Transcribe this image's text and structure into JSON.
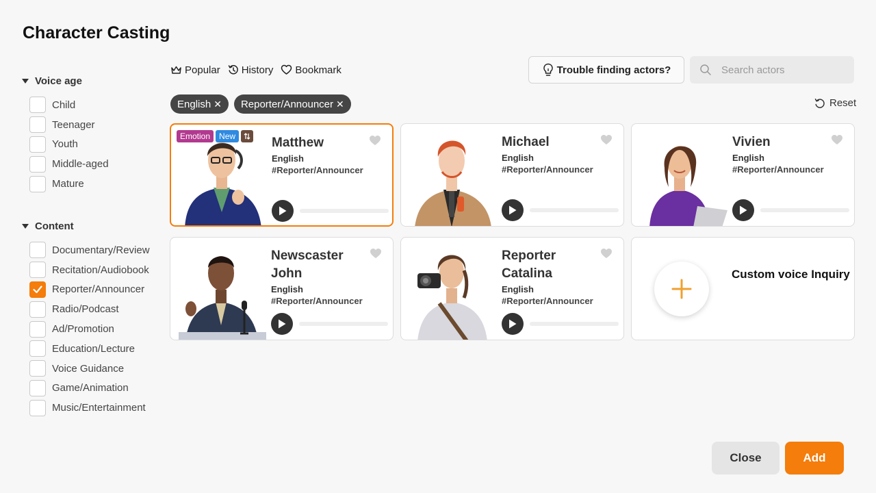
{
  "title": "Character Casting",
  "sidebar": {
    "voice_age": {
      "heading": "Voice age",
      "options": [
        {
          "label": "Child",
          "checked": false
        },
        {
          "label": "Teenager",
          "checked": false
        },
        {
          "label": "Youth",
          "checked": false
        },
        {
          "label": "Middle-aged",
          "checked": false
        },
        {
          "label": "Mature",
          "checked": false
        }
      ]
    },
    "content": {
      "heading": "Content",
      "options": [
        {
          "label": "Documentary/Review",
          "checked": false
        },
        {
          "label": "Recitation/Audiobook",
          "checked": false
        },
        {
          "label": "Reporter/Announcer",
          "checked": true
        },
        {
          "label": "Radio/Podcast",
          "checked": false
        },
        {
          "label": "Ad/Promotion",
          "checked": false
        },
        {
          "label": "Education/Lecture",
          "checked": false
        },
        {
          "label": "Voice Guidance",
          "checked": false
        },
        {
          "label": "Game/Animation",
          "checked": false
        },
        {
          "label": "Music/Entertainment",
          "checked": false
        }
      ]
    }
  },
  "toolbar": {
    "tabs": [
      {
        "label": "Popular",
        "icon": "crown-icon"
      },
      {
        "label": "History",
        "icon": "history-icon"
      },
      {
        "label": "Bookmark",
        "icon": "heart-outline-icon"
      }
    ],
    "trouble_label": "Trouble finding actors?",
    "search_placeholder": "Search actors"
  },
  "filters": {
    "chips": [
      "English",
      "Reporter/Announcer"
    ],
    "reset_label": "Reset"
  },
  "actors": [
    {
      "name": "Matthew",
      "language": "English",
      "tag": "#Reporter/Announcer",
      "badges": [
        "Emotion",
        "New"
      ],
      "selected": true
    },
    {
      "name": "Michael",
      "language": "English",
      "tag": "#Reporter/Announcer",
      "badges": [],
      "selected": false
    },
    {
      "name": "Vivien",
      "language": "English",
      "tag": "#Reporter/Announcer",
      "badges": [],
      "selected": false
    },
    {
      "name": "Newscaster John",
      "language": "English",
      "tag": "#Reporter/Announcer",
      "badges": [],
      "selected": false
    },
    {
      "name": "Reporter Catalina",
      "language": "English",
      "tag": "#Reporter/Announcer",
      "badges": [],
      "selected": false
    }
  ],
  "custom_voice_label": "Custom voice Inquiry",
  "footer": {
    "close_label": "Close",
    "add_label": "Add"
  },
  "colors": {
    "accent": "#f47d0b",
    "chip": "#454545",
    "emotion_badge": "#b2398f",
    "new_badge": "#2f8ae0"
  }
}
